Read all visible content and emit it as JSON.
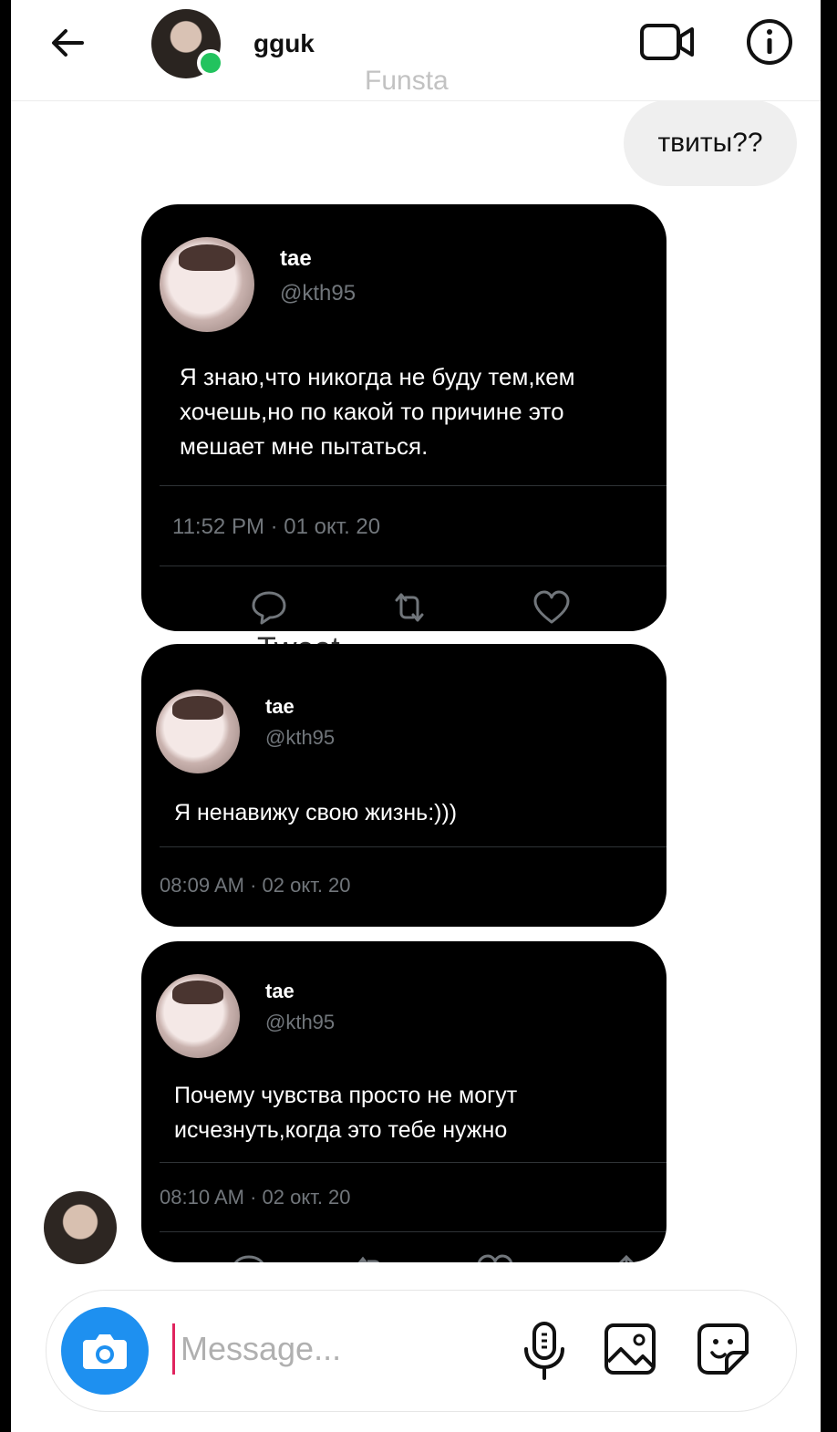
{
  "header": {
    "username": "gguk",
    "subtitle": "Funsta"
  },
  "outgoing_message": "твиты??",
  "tweets": [
    {
      "name": "tae",
      "handle": "@kth95",
      "text": "Я знаю,что никогда не буду тем,кем\nхочешь,но по какой то причине это\nмешает мне пытаться.",
      "time": "11:52 PM · 01 окт. 20"
    },
    {
      "name": "tae",
      "handle": "@kth95",
      "text": "Я ненавижу свою жизнь:)))",
      "time": "08:09 AM · 02 окт. 20"
    },
    {
      "name": "tae",
      "handle": "@kth95",
      "text": "Почему чувства просто не могут\nисчезнуть,когда это тебе нужно",
      "time": "08:10 AM · 02 окт. 20"
    }
  ],
  "tweet_caption": "Tweet",
  "composer": {
    "placeholder": "Message..."
  },
  "colors": {
    "accent_blue": "#1e90f0",
    "online_green": "#22c35e",
    "tweet_bg": "#000000",
    "tweet_muted": "#71767b",
    "outgoing_bubble": "#efefef"
  },
  "icons": [
    "back-arrow-icon",
    "video-call-icon",
    "info-icon",
    "reply-icon",
    "retweet-icon",
    "like-icon",
    "camera-icon",
    "microphone-icon",
    "gallery-icon",
    "sticker-icon"
  ]
}
